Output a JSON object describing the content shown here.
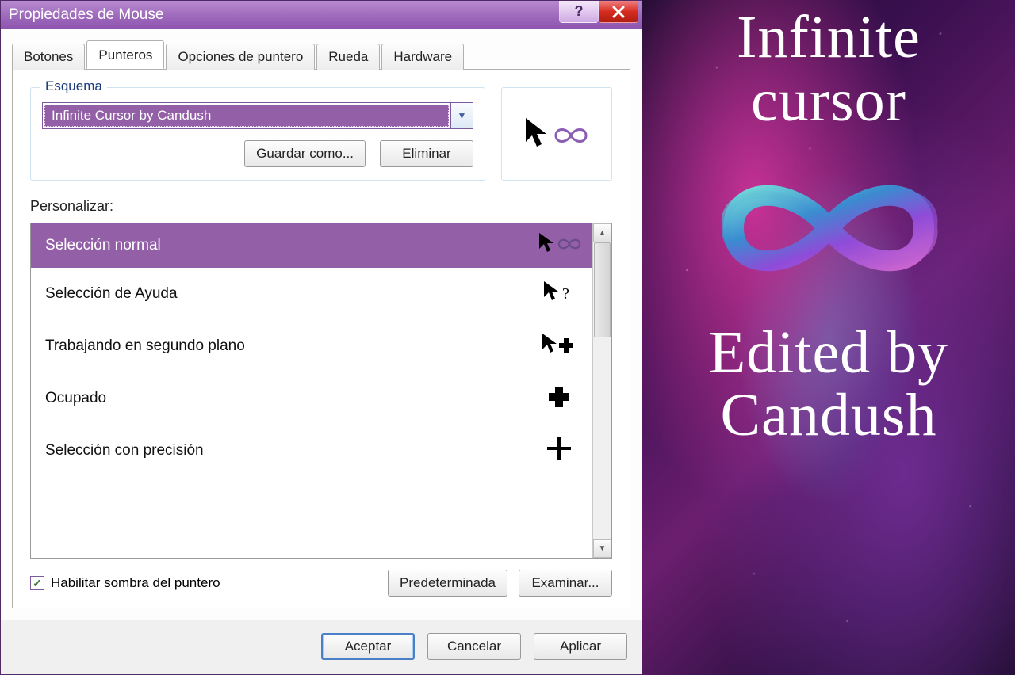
{
  "window": {
    "title": "Propiedades de Mouse"
  },
  "tabs": [
    "Botones",
    "Punteros",
    "Opciones de puntero",
    "Rueda",
    "Hardware"
  ],
  "activeTabIndex": 1,
  "scheme": {
    "group_label": "Esquema",
    "selected": "Infinite Cursor by Candush",
    "save_as": "Guardar como...",
    "delete": "Eliminar"
  },
  "personalize_label": "Personalizar:",
  "cursors": [
    {
      "label": "Selección normal",
      "icon": "arrow-infinity",
      "selected": true
    },
    {
      "label": "Selección de Ayuda",
      "icon": "arrow-help",
      "selected": false
    },
    {
      "label": "Trabajando en segundo plano",
      "icon": "arrow-busy",
      "selected": false
    },
    {
      "label": "Ocupado",
      "icon": "busy",
      "selected": false
    },
    {
      "label": "Selección con precisión",
      "icon": "precision",
      "selected": false
    }
  ],
  "shadow_checkbox": {
    "label": "Habilitar sombra del puntero",
    "checked": true
  },
  "buttons": {
    "default": "Predeterminada",
    "browse": "Examinar...",
    "ok": "Aceptar",
    "cancel": "Cancelar",
    "apply": "Aplicar"
  },
  "overlay": {
    "line1": "Infinite",
    "line2": "cursor",
    "line3": "Edited by",
    "line4": "Candush"
  }
}
